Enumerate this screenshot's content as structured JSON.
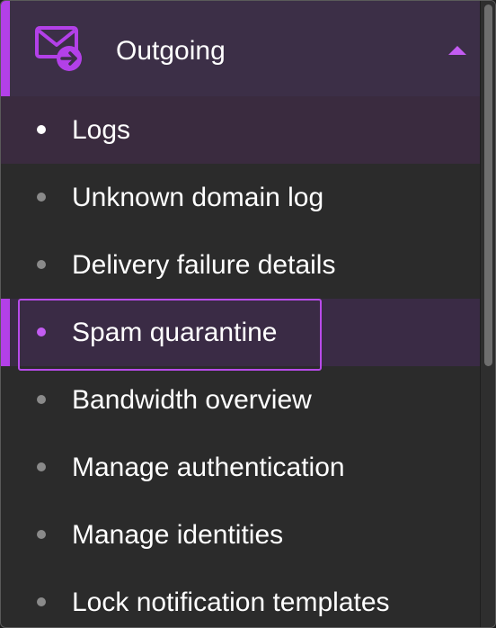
{
  "section": {
    "title": "Outgoing",
    "icon": "mail-outgoing-icon",
    "expanded": true
  },
  "items": [
    {
      "label": "Logs",
      "state": "selected"
    },
    {
      "label": "Unknown domain log",
      "state": "normal"
    },
    {
      "label": "Delivery failure details",
      "state": "normal"
    },
    {
      "label": "Spam quarantine",
      "state": "focused"
    },
    {
      "label": "Bandwidth overview",
      "state": "normal"
    },
    {
      "label": "Manage authentication",
      "state": "normal"
    },
    {
      "label": "Manage identities",
      "state": "normal"
    },
    {
      "label": "Lock notification templates",
      "state": "normal"
    }
  ],
  "colors": {
    "accent": "#b340e8",
    "header_bg": "#3c2f47",
    "panel_bg": "#2b2b2b",
    "text": "#ffffff"
  }
}
